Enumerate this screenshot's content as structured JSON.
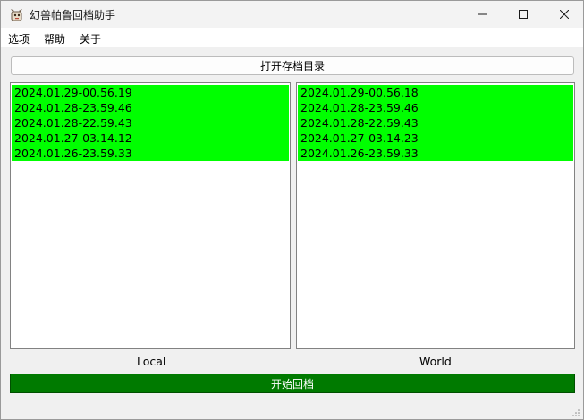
{
  "window": {
    "title": "幻兽帕鲁回档助手"
  },
  "titlebar_controls": {
    "minimize_icon": "minimize-icon",
    "maximize_icon": "maximize-icon",
    "close_icon": "close-icon"
  },
  "menu": {
    "options": "选项",
    "help": "帮助",
    "about": "关于"
  },
  "open_folder_button": "打开存档目录",
  "local": {
    "caption": "Local",
    "items": [
      "2024.01.29-00.56.19",
      "2024.01.28-23.59.46",
      "2024.01.28-22.59.43",
      "2024.01.27-03.14.12",
      "2024.01.26-23.59.33"
    ]
  },
  "world": {
    "caption": "World",
    "items": [
      "2024.01.29-00.56.18",
      "2024.01.28-23.59.46",
      "2024.01.28-22.59.43",
      "2024.01.27-03.14.23",
      "2024.01.26-23.59.33"
    ]
  },
  "start_button": "开始回档",
  "colors": {
    "list_highlight": "#00ff00",
    "start_button_bg": "#007a00"
  }
}
